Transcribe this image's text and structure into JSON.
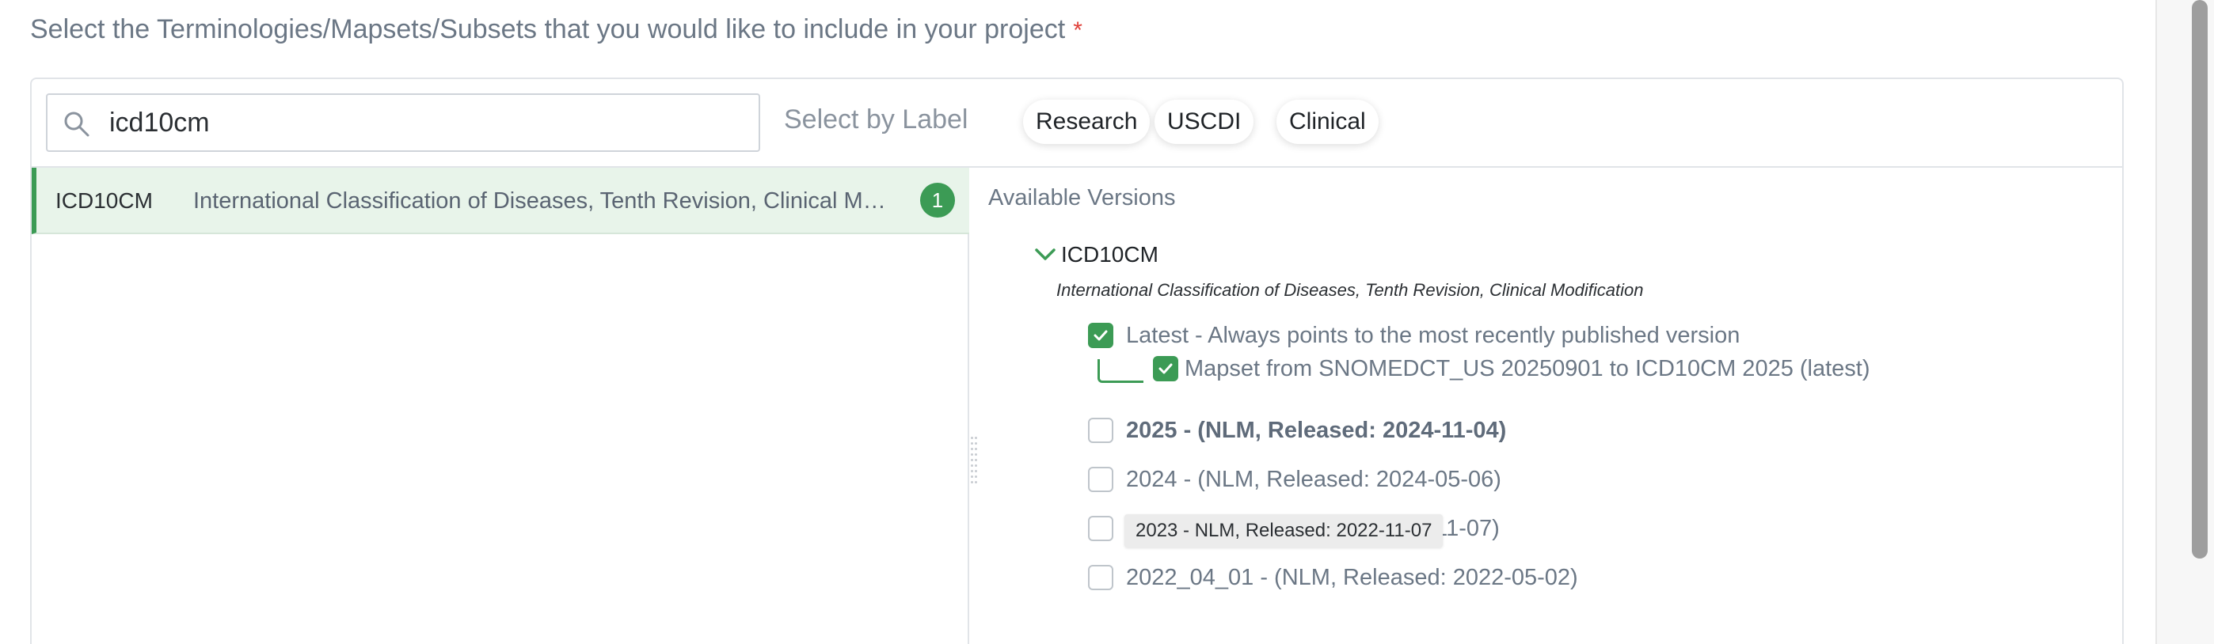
{
  "heading": {
    "text": "Select the Terminologies/Mapsets/Subsets that you would like to include in your project",
    "required_mark": "*"
  },
  "search": {
    "value": "icd10cm",
    "icon": "search-icon"
  },
  "labels": {
    "prefix": "Select by Label",
    "chips": [
      "Research",
      "USCDI",
      "Clinical"
    ]
  },
  "results": [
    {
      "code": "ICD10CM",
      "description": "International Classification of Diseases, Tenth Revision, Clinical Modification",
      "selected_count": "1"
    }
  ],
  "versions_panel": {
    "title": "Available Versions",
    "terminology": {
      "code": "ICD10CM",
      "name": "International Classification of Diseases, Tenth Revision, Clinical Modification",
      "expanded": true
    },
    "latest": {
      "label": "Latest - Always points to the most recently published version",
      "checked": true,
      "mapset": {
        "label": "Mapset from SNOMEDCT_US 20250901 to ICD10CM 2025 (latest)",
        "checked": true
      }
    },
    "versions": [
      {
        "label": "2025 - (NLM, Released: 2024-11-04)",
        "checked": false,
        "bold": true
      },
      {
        "label": "2024 - (NLM, Released: 2024-05-06)",
        "checked": false,
        "bold": false
      },
      {
        "label": "2023 - (NLM, Released: 2022-11-07)",
        "checked": false,
        "bold": false
      },
      {
        "label": "2022_04_01 - (NLM, Released: 2022-05-02)",
        "checked": false,
        "bold": false
      }
    ],
    "tooltip": "2023 - NLM, Released: 2022-11-07"
  },
  "colors": {
    "accent_green": "#3c9b55",
    "selected_row_bg": "#e8f4ea",
    "required_red": "#e0413a"
  }
}
